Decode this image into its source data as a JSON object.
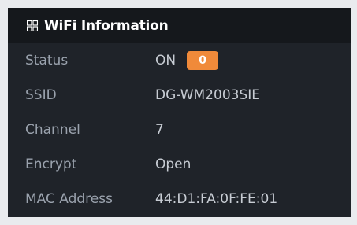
{
  "panel": {
    "title": "WiFi Information",
    "icon": "grid-icon"
  },
  "rows": [
    {
      "label": "Status",
      "value": "ON",
      "badge": "0"
    },
    {
      "label": "SSID",
      "value": "DG-WM2003SIE"
    },
    {
      "label": "Channel",
      "value": "7"
    },
    {
      "label": "Encrypt",
      "value": "Open"
    },
    {
      "label": "MAC Address",
      "value": "44:D1:FA:0F:FE:01"
    }
  ],
  "colors": {
    "panel_bg": "#1f2329",
    "header_bg": "#15181c",
    "label": "#9aa2ad",
    "value": "#c7ccd3",
    "badge_bg": "#f08a3a"
  }
}
